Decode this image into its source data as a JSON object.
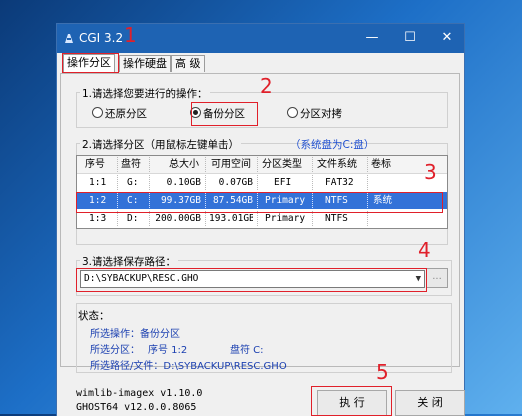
{
  "window": {
    "title": "CGI 3.2",
    "minimize": "—",
    "maximize": "☐",
    "close": "✕"
  },
  "tabs": [
    {
      "label": "操作分区"
    },
    {
      "label": "操作硬盘"
    },
    {
      "label": "高 级"
    }
  ],
  "operation": {
    "label": "1.请选择您要进行的操作：",
    "options": [
      {
        "label": "还原分区",
        "selected": false
      },
      {
        "label": "备份分区",
        "selected": true
      },
      {
        "label": "分区对拷",
        "selected": false
      }
    ]
  },
  "partition": {
    "label": "2.请选择分区（用鼠标左键单击）",
    "system_hint": "（系统盘为C:盘）",
    "columns": [
      "序号",
      "盘符",
      "总大小",
      "可用空间",
      "分区类型",
      "文件系统",
      "卷标"
    ],
    "rows": [
      {
        "index": "1:1",
        "drive": "G:",
        "total": "0.10GB",
        "free": "0.07GB",
        "type": "EFI",
        "fs": "FAT32",
        "label": "",
        "selected": false
      },
      {
        "index": "1:2",
        "drive": "C:",
        "total": "99.37GB",
        "free": "87.54GB",
        "type": "Primary",
        "fs": "NTFS",
        "label": "系统",
        "selected": true
      },
      {
        "index": "1:3",
        "drive": "D:",
        "total": "200.00GB",
        "free": "193.01GB",
        "type": "Primary",
        "fs": "NTFS",
        "label": "",
        "selected": false
      }
    ]
  },
  "path": {
    "label": "3.请选择保存路径：",
    "value": "D:\\SYBACKUP\\RESC.GHO",
    "browse": "..."
  },
  "status": {
    "label": "状态：",
    "line1": "所选操作：备份分区",
    "line2_prefix": "所选分区：",
    "line2_index": "序号 1:2",
    "line2_drive": "盘符 C:",
    "line3": "所选路径/文件：D:\\SYBACKUP\\RESC.GHO"
  },
  "versions": {
    "wimlib": "wimlib-imagex v1.10.0",
    "ghost": "GHOST64 v12.0.0.8065"
  },
  "buttons": {
    "execute": "执 行",
    "close": "关 闭"
  },
  "annotations": [
    "1",
    "2",
    "3",
    "4",
    "5"
  ],
  "colors": {
    "titlebar": "#1e63b3",
    "selection": "#3372d8",
    "annotation": "#e0202a",
    "hint": "#2050d0"
  }
}
